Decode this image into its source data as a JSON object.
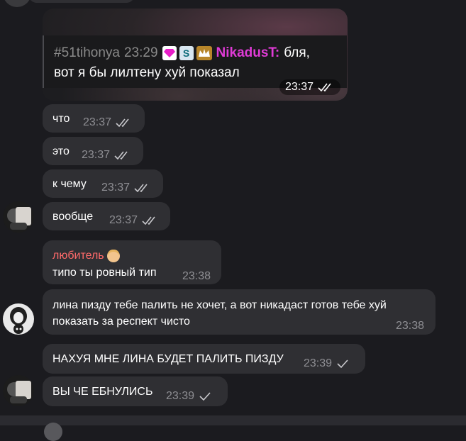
{
  "reply": {
    "user": "#51tihonya",
    "time": "23:29",
    "badge_s": "S",
    "nick": "NikadusT:",
    "text_line1": "бля,",
    "text_line2": "вот я бы лилтену хуй показал"
  },
  "media_time": "23:37",
  "messages": [
    {
      "text": "что",
      "time": "23:37",
      "status": "read"
    },
    {
      "text": "это",
      "time": "23:37",
      "status": "read"
    },
    {
      "text": "к чему",
      "time": "23:37",
      "status": "read"
    },
    {
      "text": "вообще",
      "time": "23:37",
      "status": "read"
    },
    {
      "sender": "любитель",
      "text": "типо ты ровный тип",
      "time": "23:38"
    },
    {
      "text_line1": "лина пизду тебе палить не хочет, а вот никадаст готов тебе хуй",
      "text_line2": "показать за респект чисто",
      "time": "23:38"
    },
    {
      "text": "НАХУЯ МНЕ ЛИНА БУДЕТ ПАЛИТЬ ПИЗДУ",
      "time": "23:39",
      "status": "sent"
    },
    {
      "text": "ВЫ ЧЕ ЕБНУЛИСЬ",
      "time": "23:39",
      "status": "sent"
    }
  ],
  "colors": {
    "background": "#1b1b1f",
    "bubble": "#2f2f33",
    "nick": "#e03bd6",
    "sender_name": "#ff6a6a",
    "meta": "#8e8e93"
  }
}
